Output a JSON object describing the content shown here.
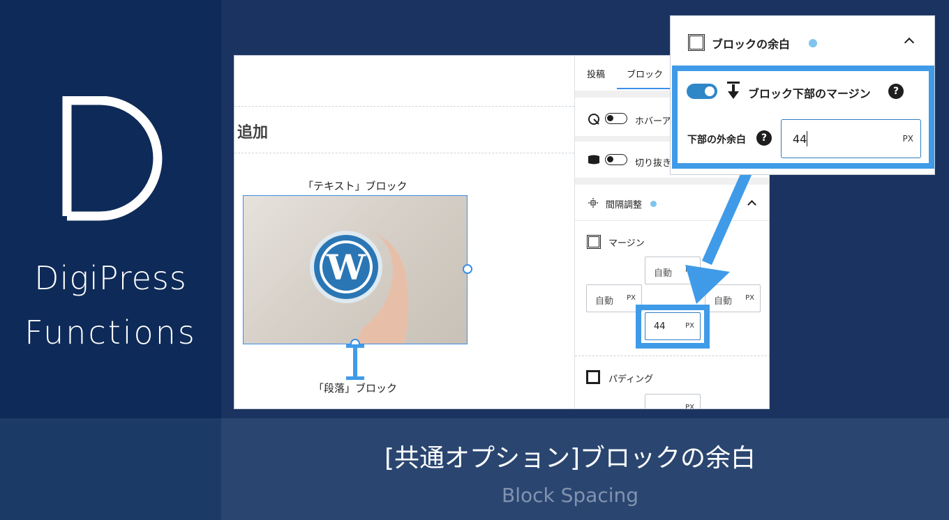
{
  "brand": {
    "line1": "DigiPress",
    "line2": "Functions"
  },
  "caption": {
    "title": "[共通オプション]ブロックの余白",
    "subtitle": "Block Spacing"
  },
  "editor": {
    "add_label": "追加",
    "text_block_label": "「テキスト」ブロック",
    "para_block_label": "「段落」ブロック",
    "sidebar": {
      "tabs": [
        "投稿",
        "ブロック"
      ],
      "hover_label": "ホバーア",
      "clip_label": "切り抜き",
      "spacing_title": "間隔調整",
      "margin_label": "マージン",
      "padding_label": "パディング",
      "margin_inputs": {
        "top": "自動",
        "left": "自動",
        "right": "自動",
        "bottom": "44",
        "unit": "PX"
      },
      "padding_unit": "PX"
    }
  },
  "popup": {
    "header": "ブロックの余白",
    "toggle_label": "ブロック下部のマージン",
    "field_label": "下部の外余白",
    "field_value": "44",
    "unit": "PX",
    "help": "?"
  },
  "colors": {
    "dark_navy": "#0e2a58",
    "navy": "#1a3360",
    "accent_blue": "#3f9be8",
    "toggle_blue": "#2f87c8"
  }
}
